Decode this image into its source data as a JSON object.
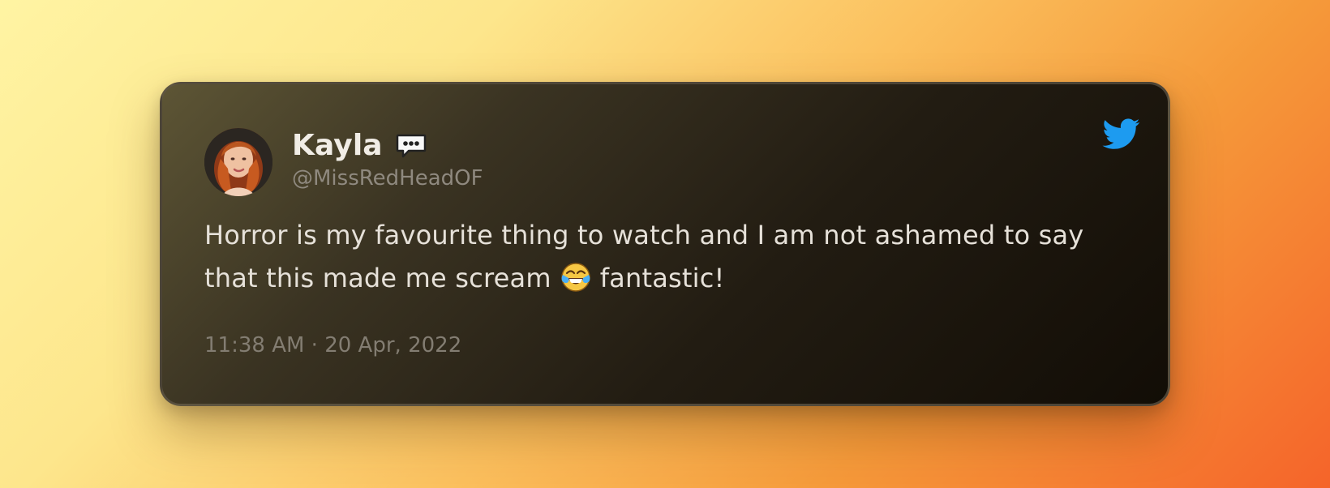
{
  "tweet": {
    "author": {
      "name": "Kayla",
      "handle": "@MissRedHeadOF",
      "name_badge_icon": "speech-bubble-icon",
      "avatar": "profile-photo"
    },
    "text_part1": "Horror is my favourite thing to watch and I am not ashamed to say that this made me scream",
    "emoji": "face-with-tears-of-joy",
    "text_part2": "fantastic!",
    "timestamp": "11:38 AM · 20 Apr, 2022",
    "platform_icon": "twitter-bird-icon"
  },
  "colors": {
    "background_start": "#fff4a3",
    "background_end": "#f5642a",
    "card": "#221c12",
    "twitter_blue": "#1d9bf0"
  }
}
